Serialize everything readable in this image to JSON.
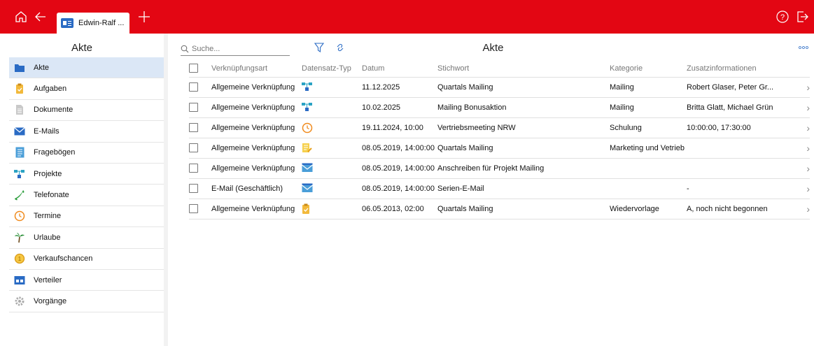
{
  "tab": {
    "label": "Edwin-Ralf ..."
  },
  "sidebar": {
    "title": "Akte",
    "items": [
      {
        "label": "Akte",
        "icon": "folder-icon"
      },
      {
        "label": "Aufgaben",
        "icon": "clipboard-icon"
      },
      {
        "label": "Dokumente",
        "icon": "document-icon"
      },
      {
        "label": "E-Mails",
        "icon": "envelope-icon"
      },
      {
        "label": "Fragebögen",
        "icon": "questionnaire-icon"
      },
      {
        "label": "Projekte",
        "icon": "project-icon"
      },
      {
        "label": "Telefonate",
        "icon": "phone-icon"
      },
      {
        "label": "Termine",
        "icon": "clock-icon"
      },
      {
        "label": "Urlaube",
        "icon": "palm-tree-icon"
      },
      {
        "label": "Verkaufschancen",
        "icon": "coin-icon"
      },
      {
        "label": "Verteiler",
        "icon": "distribution-list-icon"
      },
      {
        "label": "Vorgänge",
        "icon": "gear-icon"
      }
    ]
  },
  "main": {
    "title": "Akte",
    "search": {
      "placeholder": "Suche..."
    },
    "columns": [
      "Verknüpfungsart",
      "Datensatz-Typ",
      "Datum",
      "Stichwort",
      "Kategorie",
      "Zusatzinformationen"
    ],
    "rows": [
      {
        "link_type": "Allgemeine Verknüpfung",
        "type_icon": "project-icon",
        "date": "11.12.2025",
        "keyword": "Quartals Mailing",
        "category": "Mailing",
        "info": "Robert Glaser, Peter Gr..."
      },
      {
        "link_type": "Allgemeine Verknüpfung",
        "type_icon": "project-icon",
        "date": "10.02.2025",
        "keyword": "Mailing Bonusaktion",
        "category": "Mailing",
        "info": "Britta Glatt, Michael Grün"
      },
      {
        "link_type": "Allgemeine Verknüpfung",
        "type_icon": "clock-icon",
        "date": "19.11.2024, 10:00",
        "keyword": "Vertriebsmeeting NRW",
        "category": "Schulung",
        "info": "10:00:00, 17:30:00"
      },
      {
        "link_type": "Allgemeine Verknüpfung",
        "type_icon": "questionnaire-icon",
        "date": "08.05.2019, 14:00:00",
        "keyword": "Quartals Mailing",
        "category": "Marketing und Vetrieb",
        "info": ""
      },
      {
        "link_type": "Allgemeine Verknüpfung",
        "type_icon": "envelope-icon",
        "date": "08.05.2019, 14:00:00",
        "keyword": "Anschreiben für Projekt Mailing",
        "category": "",
        "info": ""
      },
      {
        "link_type": "E-Mail (Geschäftlich)",
        "type_icon": "envelope-icon",
        "date": "08.05.2019, 14:00:00",
        "keyword": "Serien-E-Mail",
        "category": "",
        "info": "-"
      },
      {
        "link_type": "Allgemeine Verknüpfung",
        "type_icon": "clipboard-icon",
        "date": "06.05.2013, 02:00",
        "keyword": "Quartals Mailing",
        "category": "Wiedervorlage",
        "info": "A, noch nicht begonnen"
      }
    ]
  },
  "colors": {
    "brand": "#e30613",
    "selected": "#dbe7f6",
    "icon_blue": "#2a6bc4"
  }
}
